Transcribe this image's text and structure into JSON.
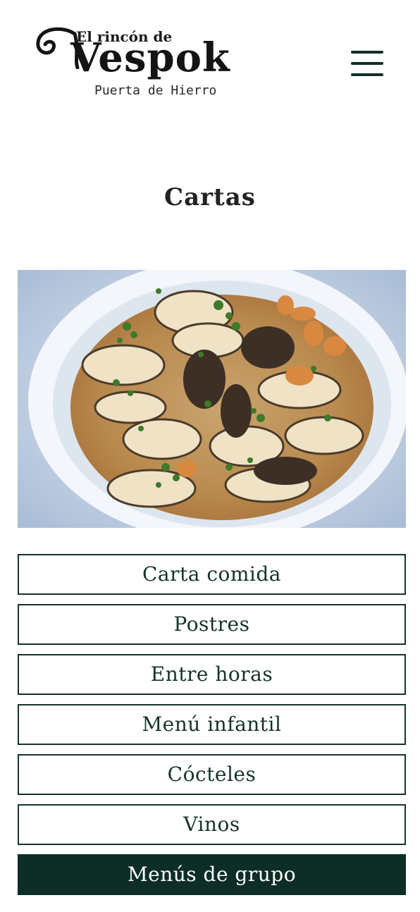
{
  "brand": {
    "top_line": "El rincón de",
    "name": "Vespok",
    "subtitle": "Puerta de Hierro"
  },
  "header": {
    "menu_icon": "hamburger-menu-icon"
  },
  "page": {
    "title": "Cartas"
  },
  "hero": {
    "image_subject": "plate of clams in sauce"
  },
  "menus": {
    "items": [
      {
        "label": "Carta comida",
        "active": false
      },
      {
        "label": "Postres",
        "active": false
      },
      {
        "label": "Entre horas",
        "active": false
      },
      {
        "label": "Menú infantil",
        "active": false
      },
      {
        "label": "Cócteles",
        "active": false
      },
      {
        "label": "Vinos",
        "active": false
      },
      {
        "label": "Menús de grupo",
        "active": true
      }
    ]
  },
  "colors": {
    "brand_dark_green": "#0d2e26",
    "text": "#16332b",
    "background": "#ffffff"
  }
}
